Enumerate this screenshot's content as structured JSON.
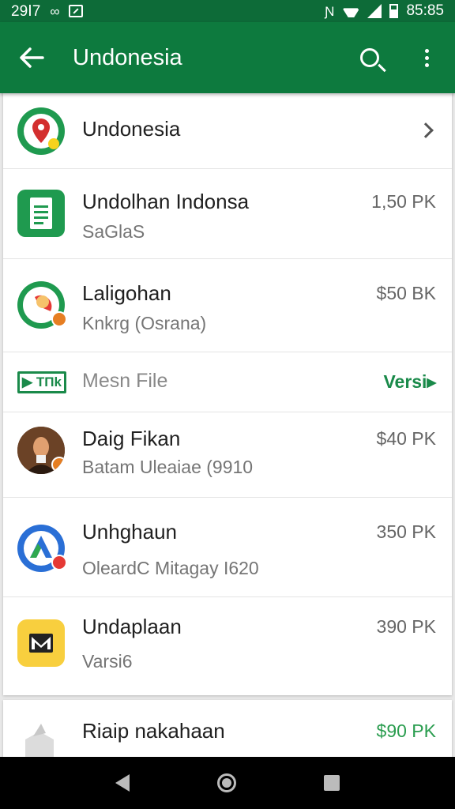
{
  "status_bar": {
    "time_left": "29Ⅰ7",
    "time_right": "85:85",
    "icons": [
      "infinity-icon",
      "image-icon",
      "nfc-icon",
      "wifi-icon",
      "signal-icon",
      "battery-icon"
    ]
  },
  "app_bar": {
    "title": "Undonesia",
    "icons": [
      "back-arrow-icon",
      "search-icon",
      "overflow-menu-icon"
    ]
  },
  "header_row": {
    "title": "Undonesia"
  },
  "items": [
    {
      "title": "Undolhan Indonsa",
      "subtitle": "SaGlaS",
      "price": "1,50 PK",
      "icon": "document-icon"
    },
    {
      "title": "Laligohan",
      "subtitle": "Knkrg (Osrana)",
      "price": "$50 BK",
      "icon": "target-icon"
    }
  ],
  "section": {
    "badge_text": "▶ TΠk",
    "label": "Mesn File",
    "action": "Versi▸"
  },
  "items2": [
    {
      "title": "Daig Fikan",
      "subtitle": "Batam Uleaiae (9910",
      "price": "$40 PK",
      "icon": "avatar-photo"
    },
    {
      "title": "Unhghaun",
      "subtitle": "OleardC  Mitagay I620",
      "price": "350 PK",
      "icon": "a-logo-icon"
    },
    {
      "title": "Undaplaan",
      "subtitle": "Varsi6",
      "price": "390 PK",
      "icon": "mail-icon"
    }
  ],
  "bottom_item": {
    "title": "Riaip nakahaan",
    "price": "$90 PK",
    "icon": "box-icon"
  },
  "colors": {
    "status_bar": "#0d6b38",
    "app_bar": "#0d7a3e",
    "accent_green": "#1a8a4a",
    "price_green": "#2a9d4f"
  }
}
